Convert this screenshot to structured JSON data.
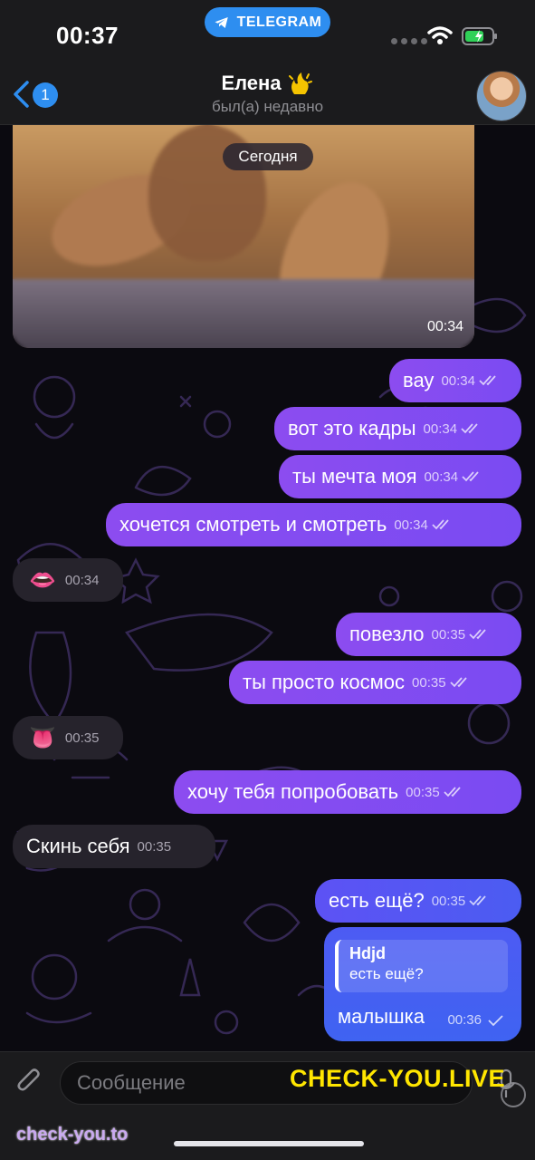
{
  "status_bar": {
    "time": "00:37",
    "app_pill": "TELEGRAM"
  },
  "header": {
    "back_count": "1",
    "name": "Елена",
    "status": "был(а) недавно"
  },
  "video": {
    "date_label": "Сегодня",
    "time": "00:34"
  },
  "messages": [
    {
      "dir": "out",
      "text": "вау",
      "time": "00:34"
    },
    {
      "dir": "out",
      "text": "вот это кадры",
      "time": "00:34"
    },
    {
      "dir": "out",
      "text": "ты мечта моя",
      "time": "00:34"
    },
    {
      "dir": "out",
      "text": "хочется смотреть и смотреть",
      "time": "00:34"
    },
    {
      "dir": "in",
      "emoji": "👄",
      "time": "00:34"
    },
    {
      "dir": "out",
      "text": "повезло",
      "time": "00:35"
    },
    {
      "dir": "out",
      "text": "ты просто космос",
      "time": "00:35"
    },
    {
      "dir": "in",
      "emoji": "👅",
      "time": "00:35"
    },
    {
      "dir": "out",
      "text": "хочу тебя попробовать",
      "time": "00:35"
    },
    {
      "dir": "in",
      "text": "Скинь себя",
      "time": "00:35"
    },
    {
      "dir": "out",
      "text": "есть ещё?",
      "time": "00:35"
    }
  ],
  "reply": {
    "quote_name": "Hdjd",
    "quote_text": "есть ещё?",
    "text": "малышка",
    "time": "00:36"
  },
  "input": {
    "placeholder": "Сообщение"
  },
  "watermarks": {
    "top": "CHECK-YOU.LIVE",
    "bottom": "check-you.to"
  },
  "colors": {
    "accent": "#2e8ef0",
    "outgoing": "#8a4cf0",
    "incoming": "#26232c",
    "watermark": "#ffe600"
  },
  "icons": [
    "telegram-icon",
    "wifi-icon",
    "battery-icon",
    "back-chevron-icon",
    "fire-emoji-icon",
    "double-check-icon",
    "paperclip-icon",
    "sticker-icon",
    "mic-icon"
  ]
}
